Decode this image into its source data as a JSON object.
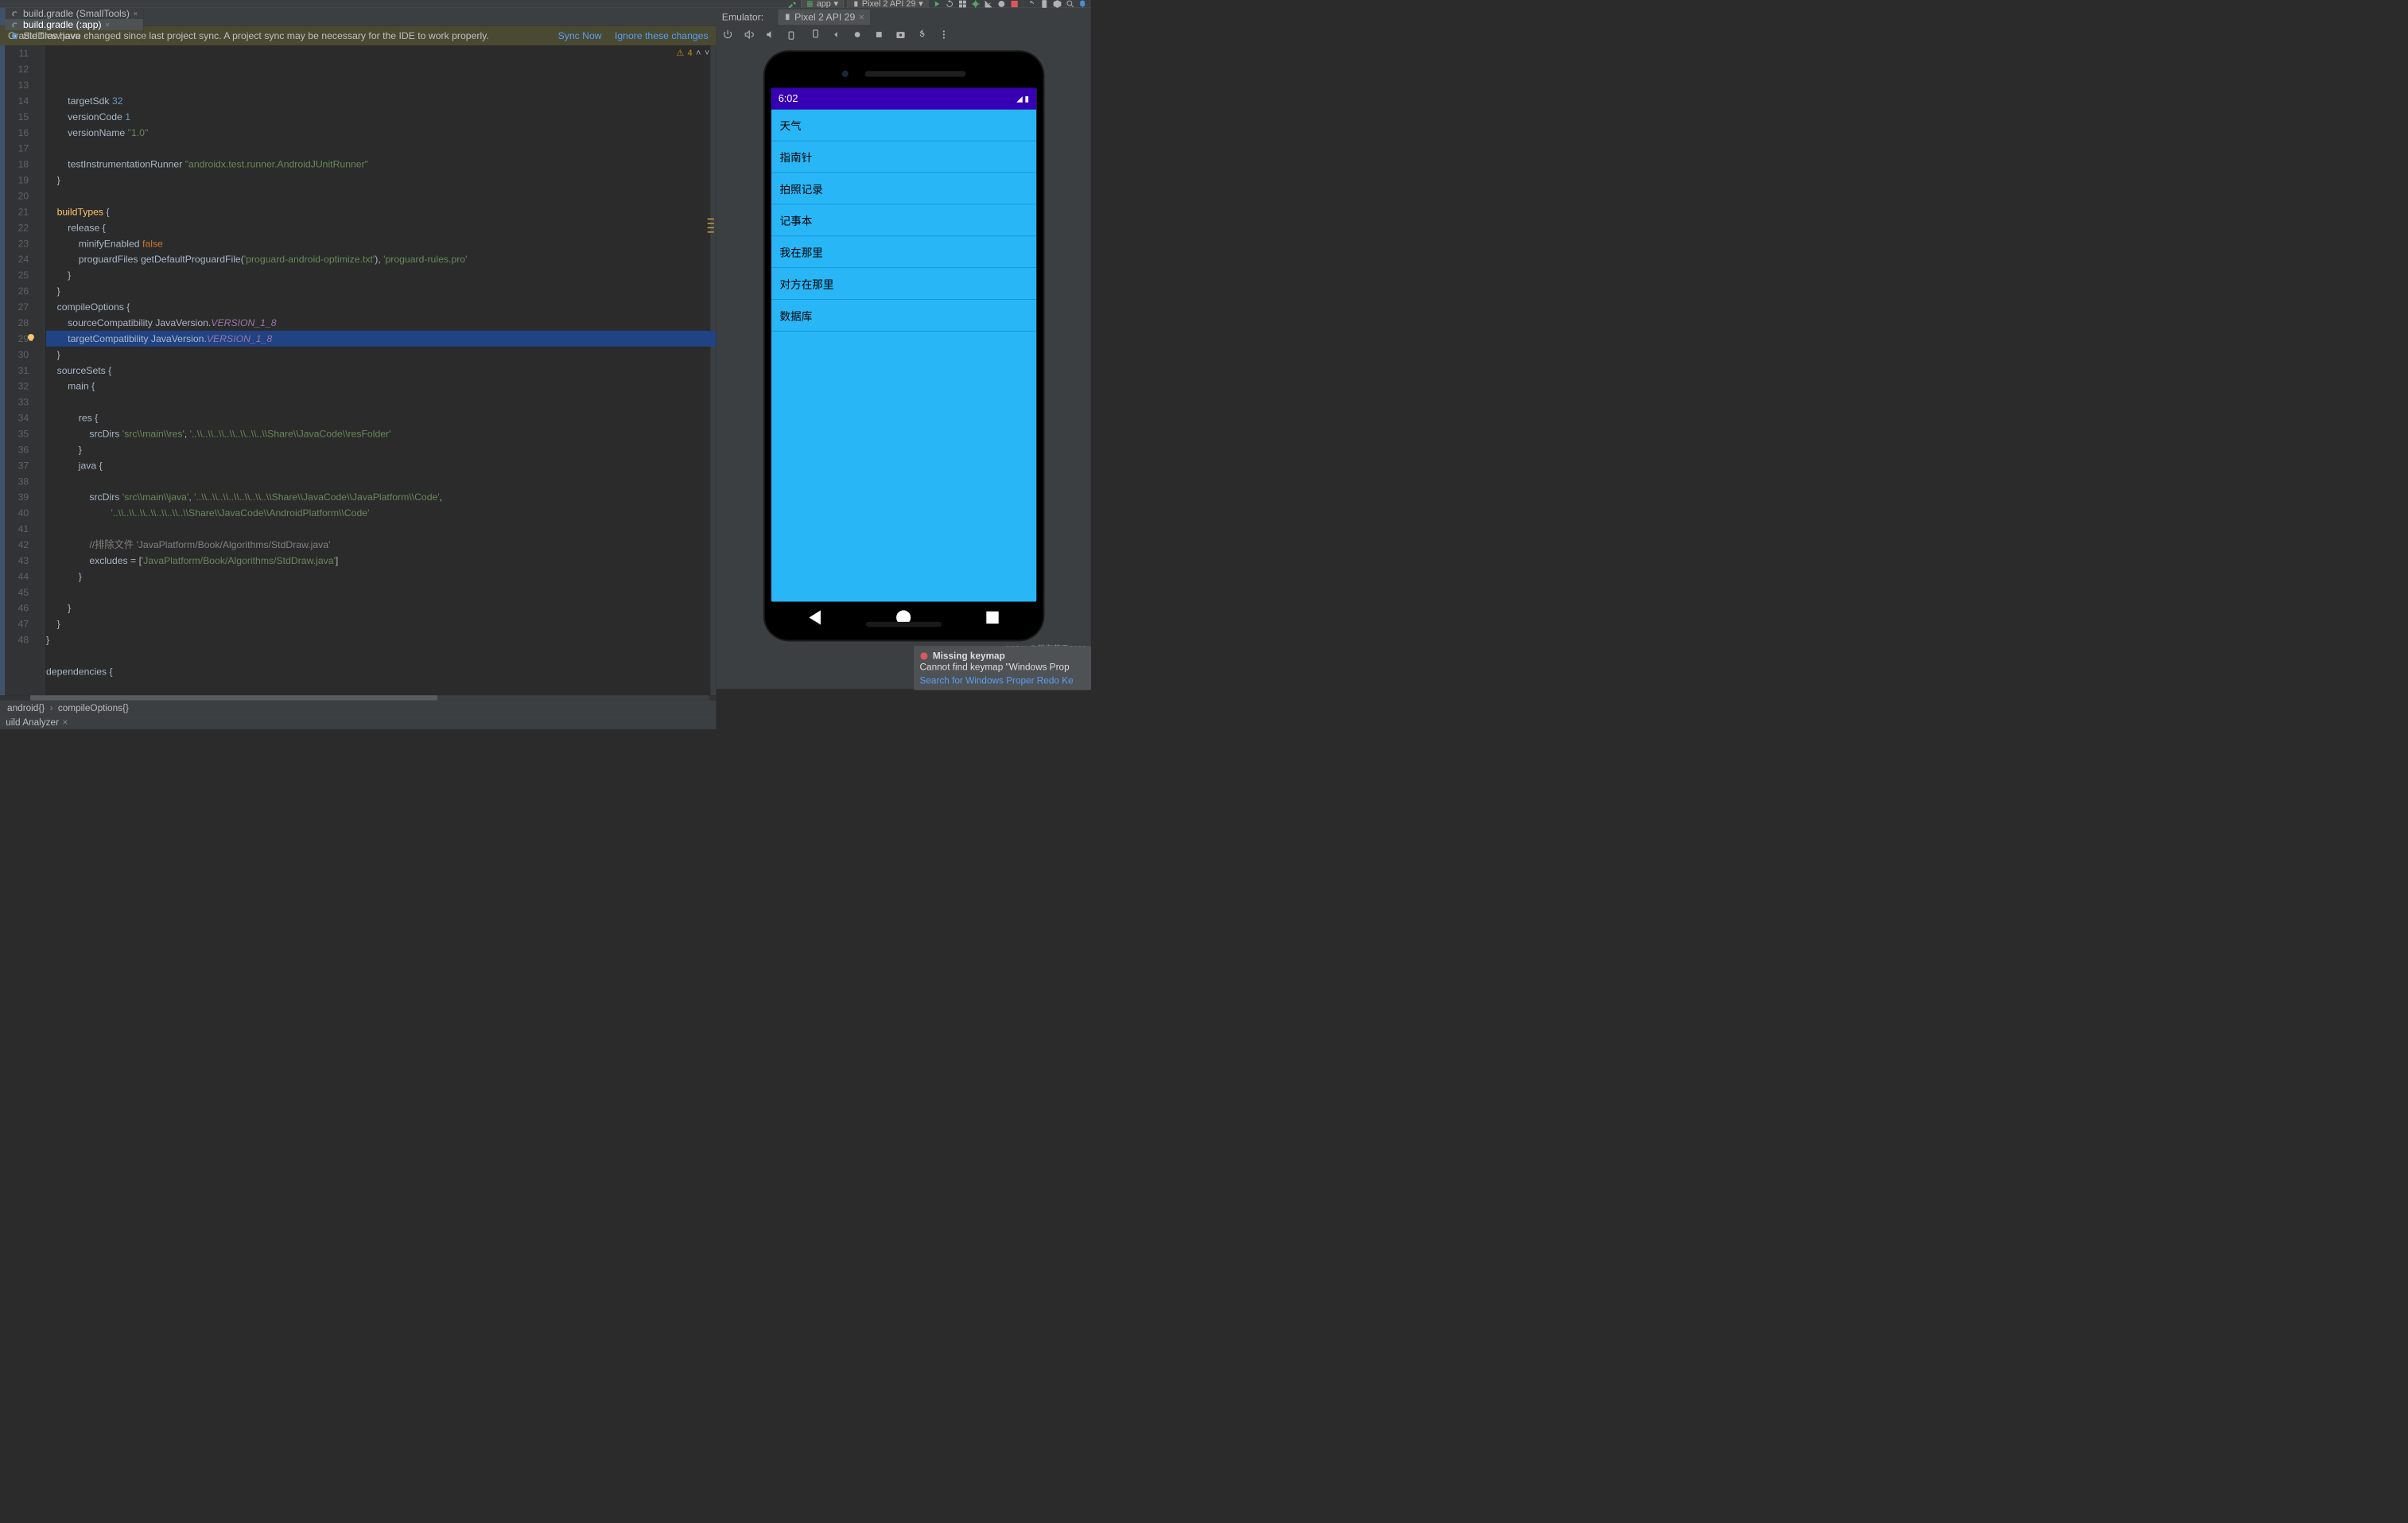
{
  "toolbar": {
    "items": [
      "hammer",
      "run-select",
      "device-select",
      "run",
      "restart",
      "profile",
      "debug",
      "apply",
      "stop",
      "adb",
      "sync",
      "avd",
      "sdk",
      "help",
      "elephant"
    ],
    "run_select": "app",
    "device_select": "Pixel 2 API 29"
  },
  "tabs": [
    {
      "label": "build.gradle (SmallTools)",
      "icon": "gradle",
      "active": false
    },
    {
      "label": "build.gradle (:app)",
      "icon": "gradle",
      "active": true
    },
    {
      "label": "StdDraw.java",
      "icon": "java",
      "active": false
    }
  ],
  "emulator": {
    "label": "Emulator:",
    "tab": "Pixel 2 API 29"
  },
  "banner": {
    "message": "Gradle files have changed since last project sync. A project sync may be necessary for the IDE to work properly.",
    "sync": "Sync Now",
    "ignore": "Ignore these changes"
  },
  "problems": {
    "warn_icon": "⚠",
    "count": "4"
  },
  "line_start": 11,
  "highlight_line": 26,
  "code": [
    [
      {
        "t": "        targetSdk ",
        "c": "id"
      },
      {
        "t": "32",
        "c": "num"
      }
    ],
    [
      {
        "t": "        versionCode ",
        "c": "id"
      },
      {
        "t": "1",
        "c": "num"
      }
    ],
    [
      {
        "t": "        versionName ",
        "c": "id"
      },
      {
        "t": "\"1.0\"",
        "c": "str"
      }
    ],
    [
      {
        "t": "",
        "c": "id"
      }
    ],
    [
      {
        "t": "        testInstrumentationRunner ",
        "c": "id"
      },
      {
        "t": "\"androidx.test.runner.AndroidJUnitRunner\"",
        "c": "str"
      }
    ],
    [
      {
        "t": "    }",
        "c": "id"
      }
    ],
    [
      {
        "t": "",
        "c": "id"
      }
    ],
    [
      {
        "t": "    buildTypes ",
        "c": "fn"
      },
      {
        "t": "{",
        "c": "id"
      }
    ],
    [
      {
        "t": "        release ",
        "c": "id"
      },
      {
        "t": "{",
        "c": "id"
      }
    ],
    [
      {
        "t": "            minifyEnabled ",
        "c": "id"
      },
      {
        "t": "false",
        "c": "key"
      }
    ],
    [
      {
        "t": "            proguardFiles ",
        "c": "id"
      },
      {
        "t": "getDefaultProguardFile",
        "c": "id"
      },
      {
        "t": "(",
        "c": "id"
      },
      {
        "t": "'proguard-android-optimize.txt'",
        "c": "str"
      },
      {
        "t": "), ",
        "c": "id"
      },
      {
        "t": "'proguard-rules.pro'",
        "c": "str"
      }
    ],
    [
      {
        "t": "        }",
        "c": "id"
      }
    ],
    [
      {
        "t": "    }",
        "c": "id"
      }
    ],
    [
      {
        "t": "    compileOptions ",
        "c": "id"
      },
      {
        "t": "{",
        "c": "id"
      }
    ],
    [
      {
        "t": "        sourceCompatibility ",
        "c": "id"
      },
      {
        "t": "JavaVersion.",
        "c": "id"
      },
      {
        "t": "VERSION_1_8",
        "c": "sit"
      }
    ],
    [
      {
        "t": "        targetCompatibility ",
        "c": "id"
      },
      {
        "t": "JavaVersion.",
        "c": "id"
      },
      {
        "t": "VERSION_1_8",
        "c": "sit"
      }
    ],
    [
      {
        "t": "    }",
        "c": "id"
      }
    ],
    [
      {
        "t": "    sourceSets ",
        "c": "id"
      },
      {
        "t": "{",
        "c": "id"
      }
    ],
    [
      {
        "t": "        main ",
        "c": "id"
      },
      {
        "t": "{",
        "c": "id"
      }
    ],
    [
      {
        "t": "",
        "c": "id"
      }
    ],
    [
      {
        "t": "            res ",
        "c": "id"
      },
      {
        "t": "{",
        "c": "id"
      }
    ],
    [
      {
        "t": "                srcDirs ",
        "c": "id"
      },
      {
        "t": "'src\\\\main\\\\res'",
        "c": "str"
      },
      {
        "t": ", ",
        "c": "id"
      },
      {
        "t": "'..\\\\..\\\\..\\\\..\\\\..\\\\..\\\\..\\\\Share\\\\JavaCode\\\\resFolder'",
        "c": "str"
      }
    ],
    [
      {
        "t": "            }",
        "c": "id"
      }
    ],
    [
      {
        "t": "            java ",
        "c": "id"
      },
      {
        "t": "{",
        "c": "id"
      }
    ],
    [
      {
        "t": "",
        "c": "id"
      }
    ],
    [
      {
        "t": "                srcDirs ",
        "c": "id"
      },
      {
        "t": "'src\\\\main\\\\java'",
        "c": "str"
      },
      {
        "t": ", ",
        "c": "id"
      },
      {
        "t": "'..\\\\..\\\\..\\\\..\\\\..\\\\..\\\\..\\\\Share\\\\JavaCode\\\\JavaPlatform\\\\Code'",
        "c": "str"
      },
      {
        "t": ",",
        "c": "id"
      }
    ],
    [
      {
        "t": "                        ",
        "c": "id"
      },
      {
        "t": "'..\\\\..\\\\..\\\\..\\\\..\\\\..\\\\..\\\\Share\\\\JavaCode\\\\AndroidPlatform\\\\Code'",
        "c": "str"
      }
    ],
    [
      {
        "t": "",
        "c": "id"
      }
    ],
    [
      {
        "t": "                //排除文件 'JavaPlatform/Book/Algorithms/StdDraw.java'",
        "c": "com"
      }
    ],
    [
      {
        "t": "                excludes ",
        "c": "id"
      },
      {
        "t": "= [",
        "c": "id"
      },
      {
        "t": "'JavaPlatform/Book/Algorithms/StdDraw.java'",
        "c": "str"
      },
      {
        "t": "]",
        "c": "id"
      }
    ],
    [
      {
        "t": "            }",
        "c": "id"
      }
    ],
    [
      {
        "t": "",
        "c": "id"
      }
    ],
    [
      {
        "t": "        }",
        "c": "id"
      }
    ],
    [
      {
        "t": "    }",
        "c": "id"
      }
    ],
    [
      {
        "t": "}",
        "c": "id"
      }
    ],
    [
      {
        "t": "",
        "c": "id"
      }
    ],
    [
      {
        "t": "dependencies ",
        "c": "id"
      },
      {
        "t": "{",
        "c": "id"
      }
    ],
    [
      {
        "t": "",
        "c": "id"
      }
    ]
  ],
  "breadcrumb": [
    "android{}",
    "compileOptions{}"
  ],
  "bottom_tab": "uild Analyzer",
  "emu_toolbar": [
    "power",
    "volume-up",
    "volume-down",
    "rotate-left",
    "rotate-right",
    "back",
    "home",
    "overview",
    "camera",
    "record",
    "more"
  ],
  "phone": {
    "time": "6:02",
    "list": [
      "天气",
      "指南针",
      "拍照记录",
      "记事本",
      "我在那里",
      "对方在那里",
      "数据库"
    ]
  },
  "notification": {
    "title": "Missing keymap",
    "body": "Cannot find keymap \"Windows Prop",
    "link": "Search for Windows Proper Redo Ke"
  },
  "watermark": "CSDN @碧海蓝天2022"
}
